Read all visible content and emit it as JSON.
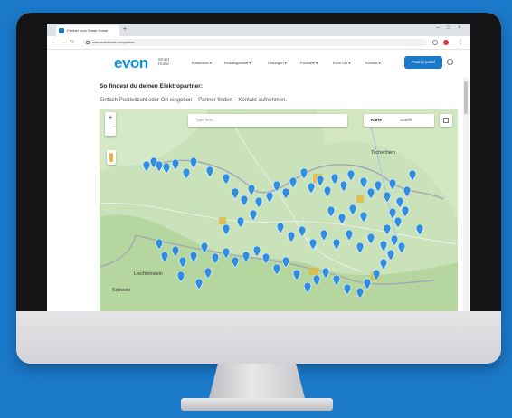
{
  "browser": {
    "tab_title": "Partner zum Smart Home",
    "url": "www.smarthome.com/partner",
    "new_tab": "+",
    "win_controls": [
      "–",
      "□",
      "×"
    ]
  },
  "site": {
    "logo": "evon",
    "logo_sub": "Smart Home",
    "menu": [
      "Entdecken ▾",
      "Einsatzgebiete ▾",
      "Lösungen ▾",
      "Produkte ▾",
      "Evon Uni ▾",
      "Kontakt ▾"
    ],
    "cta": "Partnerportal"
  },
  "content": {
    "heading": "So findest du deinen Elektropartner:",
    "subtext": "Einfach Postleitzahl oder Ort eingeben – Partner finden – Kontakt aufnehmen."
  },
  "map": {
    "search_placeholder": "Type here...",
    "type_map": "Karte",
    "type_satellite": "Satellit",
    "zoom_in": "+",
    "zoom_out": "−",
    "labels": {
      "czech": "Tschechien",
      "liechtenstein": "Liechtenstein",
      "switzerland": "Schweiz"
    },
    "colors": {
      "land": "#c9e2b9",
      "border": "#a7a2b8",
      "pin_blue": "#2f8ee0",
      "pin_yellow": "#e2b83c"
    }
  }
}
